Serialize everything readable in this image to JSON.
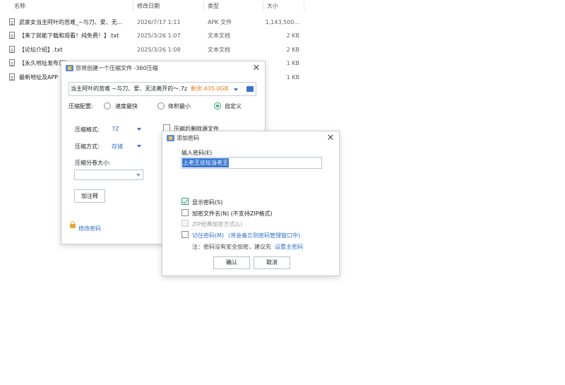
{
  "explorer": {
    "columns": {
      "name": "名称",
      "date": "修改日期",
      "type": "类型",
      "size": "大小"
    },
    "sort_indicator": "^",
    "files": [
      {
        "name": "武家女当主阿叶的苦难_~与刀、爱、无...",
        "date": "2026/7/17 1:11",
        "type": "APK 文件",
        "size": "1,143,500..."
      },
      {
        "name": "【来了就能下载和观看！纯免费！】.txt",
        "date": "2025/3/26 1:07",
        "type": "文本文档",
        "size": "2 KB"
      },
      {
        "name": "【论坛介绍】.txt",
        "date": "2025/3/26 1:08",
        "type": "文本文档",
        "size": "2 KB"
      },
      {
        "name": "【永久地址发布页】",
        "date": "",
        "type": "",
        "size": "1 KB"
      },
      {
        "name": "最新地址及APP",
        "date": "",
        "type": "",
        "size": "1 KB"
      }
    ]
  },
  "compress_dialog": {
    "title": "您将创建一个压缩文件 -360压缩",
    "filename": "当主阿叶的苦难 ~与刀、爱、无法离开的～.7z",
    "remaining": "剩余:435.0GB",
    "config_label": "压缩配置:",
    "options": [
      "速度最快",
      "体积最小",
      "自定义"
    ],
    "format_label": "压缩格式:",
    "format_value": "7Z",
    "delete_after": "压缩后删除源文件",
    "method_label": "压缩方式:",
    "method_value": "存储",
    "split_label": "压缩分卷大小:",
    "split_value": "",
    "comment_button": "加注释",
    "password_link": "修改密码"
  },
  "password_dialog": {
    "title": "添加密码",
    "input_label": "输入密码(E)",
    "password_value": "上老王论坛当老王",
    "show_password": "显示密码(S)",
    "encrypt_names": "加密文件名(N) (不支持ZIP格式)",
    "zip_classic": "ZIP经典加密方式(L)",
    "remember_prefix": "记住密码(M)",
    "remember_note": "(将会备忘到密码管理窗口中)",
    "note_prefix": "注：密码没有安全加密，建议先",
    "note_link": "设置主密码",
    "ok_button": "确认",
    "cancel_button": "取消"
  },
  "colors": {
    "accent_blue": "#2f6fc6",
    "accent_green": "#2fa36b",
    "remaining_orange": "#e07b1f",
    "selection": "#3a78d4"
  }
}
